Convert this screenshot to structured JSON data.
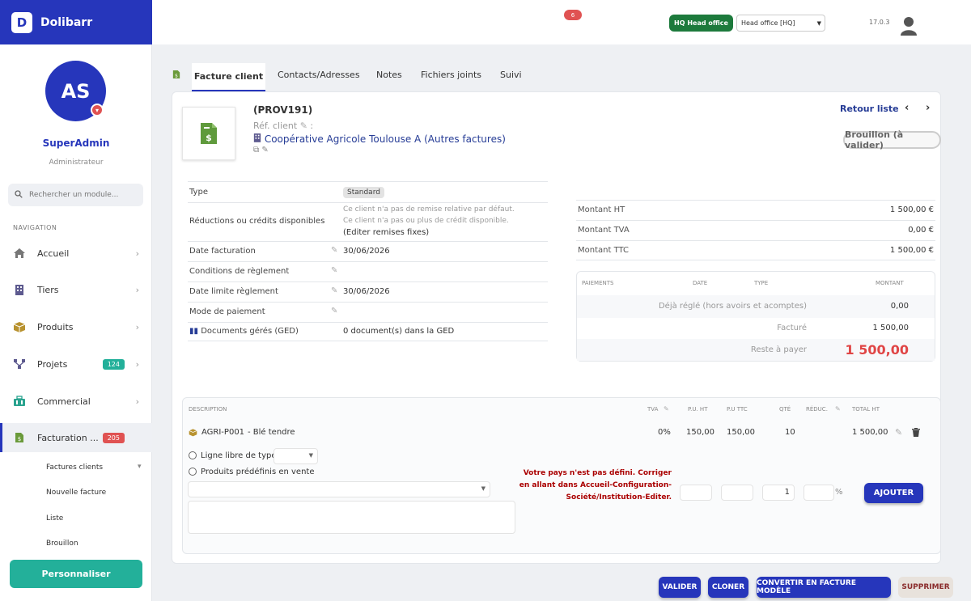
{
  "brand": {
    "name": "Dolibarr",
    "logo_letter": "D"
  },
  "user": {
    "initials": "AS",
    "name": "SuperAdmin",
    "role": "Administrateur"
  },
  "search": {
    "placeholder": "Rechercher un module..."
  },
  "nav": {
    "heading": "NAVIGATION",
    "items": [
      {
        "label": "Accueil",
        "icon": "home-icon"
      },
      {
        "label": "Tiers",
        "icon": "building-icon"
      },
      {
        "label": "Produits",
        "icon": "box-icon"
      },
      {
        "label": "Projets",
        "icon": "project-icon",
        "badge": "124"
      },
      {
        "label": "Commercial",
        "icon": "briefcase-icon"
      },
      {
        "label": "Facturation ...",
        "icon": "invoice-icon",
        "badge": "205"
      }
    ],
    "sub_items": [
      "Factures clients",
      "Nouvelle facture",
      "Liste",
      "Brouillon"
    ],
    "customize_label": "Personnaliser"
  },
  "topbar": {
    "notif_count": "6",
    "entity_badge": "HQ Head office",
    "entity_select": "Head office [HQ]",
    "version": "17.0.3"
  },
  "tabs": [
    "Facture client",
    "Contacts/Adresses",
    "Notes",
    "Fichiers joints",
    "Suivi"
  ],
  "invoice": {
    "ref": "(PROV191)",
    "ref_client_label": "Réf. client",
    "ref_client_suffix": ":",
    "company": "Coopérative Agricole Toulouse A",
    "company_suffix": "(Autres factures)",
    "back_list": "Retour liste",
    "status": "Brouillon (à valider)"
  },
  "fields": {
    "type_label": "Type",
    "type_value": "Standard",
    "reductions_label": "Réductions ou crédits disponibles",
    "reductions_line1": "Ce client n'a pas de remise relative par défaut.",
    "reductions_line2": "Ce client n'a pas ou plus de crédit disponible.",
    "reductions_link": "(Editer remises fixes)",
    "date_label": "Date facturation",
    "date_value": "30/06/2026",
    "conditions_label": "Conditions de règlement",
    "due_label": "Date limite règlement",
    "due_value": "30/06/2026",
    "mode_label": "Mode de paiement",
    "ged_label": "Documents gérés (GED)",
    "ged_value": "0 document(s) dans la GED"
  },
  "amounts": {
    "ht_label": "Montant HT",
    "ht_value": "1 500,00 €",
    "tva_label": "Montant TVA",
    "tva_value": "0,00 €",
    "ttc_label": "Montant TTC",
    "ttc_value": "1 500,00 €"
  },
  "payments": {
    "headers": [
      "PAIEMENTS",
      "DATE",
      "TYPE",
      "MONTANT"
    ],
    "already_label": "Déjà réglé (hors avoirs et acomptes)",
    "already_value": "0,00",
    "billed_label": "Facturé",
    "billed_value": "1 500,00",
    "remaining_label": "Reste à payer",
    "remaining_value": "1 500,00"
  },
  "lines": {
    "headers": [
      "DESCRIPTION",
      "TVA",
      "P.U. HT",
      "P.U TTC",
      "QTÉ",
      "RÉDUC.",
      "TOTAL HT"
    ],
    "row": {
      "code": "AGRI-P001",
      "desc": "- Blé tendre",
      "tva": "0%",
      "pu_ht": "150,00",
      "pu_ttc": "150,00",
      "qty": "10",
      "total": "1 500,00"
    },
    "free_line_label": "Ligne libre de type",
    "predefined_label": "Produits prédéfinis en vente",
    "qty_default": "1",
    "percent": "%",
    "warning": "Votre pays n'est pas défini. Corriger en allant dans Accueil-Configuration-Société/Institution-Editer.",
    "add_button": "AJOUTER"
  },
  "actions": [
    "VALIDER",
    "CLONER",
    "CONVERTIR EN FACTURE MODÈLE",
    "SUPPRIMER"
  ],
  "colors": {
    "brand": "#2636bb",
    "accent_green": "#23b09a",
    "danger": "#e05252"
  }
}
